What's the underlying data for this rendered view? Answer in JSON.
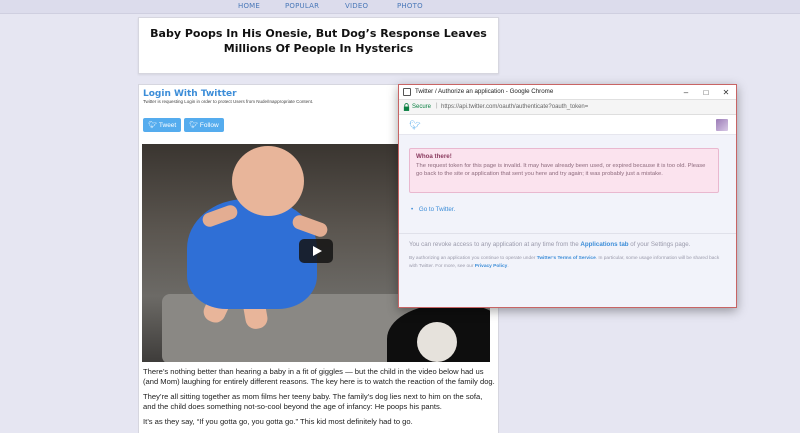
{
  "nav": {
    "items": [
      "HOME",
      "POPULAR",
      "VIDEO",
      "PHOTO"
    ]
  },
  "headline": {
    "title": "Baby Poops In His Onesie, But Dog’s Response Leaves Millions Of People In Hysterics"
  },
  "login": {
    "title": "Login With Twitter",
    "subtitle": "Twitter is requesting Login in order to protect Users from Nude/Inappropriate Content.",
    "tweet_label": "Tweet",
    "follow_label": "Follow"
  },
  "article": {
    "paragraphs": [
      " There’s nothing better than hearing a baby in a fit of giggles — but the child in the video below had us (and Mom) laughing for entirely different reasons. The key here is to watch the reaction of the family dog.",
      "They’re all sitting together as mom films her teeny baby. The family’s dog lies next to him on the sofa, and the child does something not-so-cool beyond the age of infancy: He poops his pants.",
      "It’s as they say, “If you gotta go, you gotta go.” This kid most definitely had to go."
    ]
  },
  "popup": {
    "window_title": "Twitter / Authorize an application - Google Chrome",
    "secure_label": "Secure",
    "url": "https://api.twitter.com/oauth/authenticate?oauth_token=",
    "alert": {
      "heading": "Whoa there!",
      "body": "The request token for this page is invalid. It may have already been used, or expired because it is too old. Please go back to the site or application that sent you here and try again; it was probably just a mistake."
    },
    "goto_link": "Go to Twitter.",
    "revoke": {
      "prefix": "You can revoke access to any application at any time from the ",
      "link": "Applications tab",
      "suffix": " of your Settings page."
    },
    "legal": {
      "prefix": "By authorizing an application you continue to operate under ",
      "link1": "Twitter’s Terms of Service",
      "middle": ". In particular, some usage information will be shared back with Twitter. For more, see our ",
      "link2": "Privacy Policy",
      "suffix": "."
    }
  },
  "colors": {
    "twitter_blue": "#55acee",
    "link_blue": "#3c8dd8",
    "alert_bg": "#fbe3ee"
  }
}
